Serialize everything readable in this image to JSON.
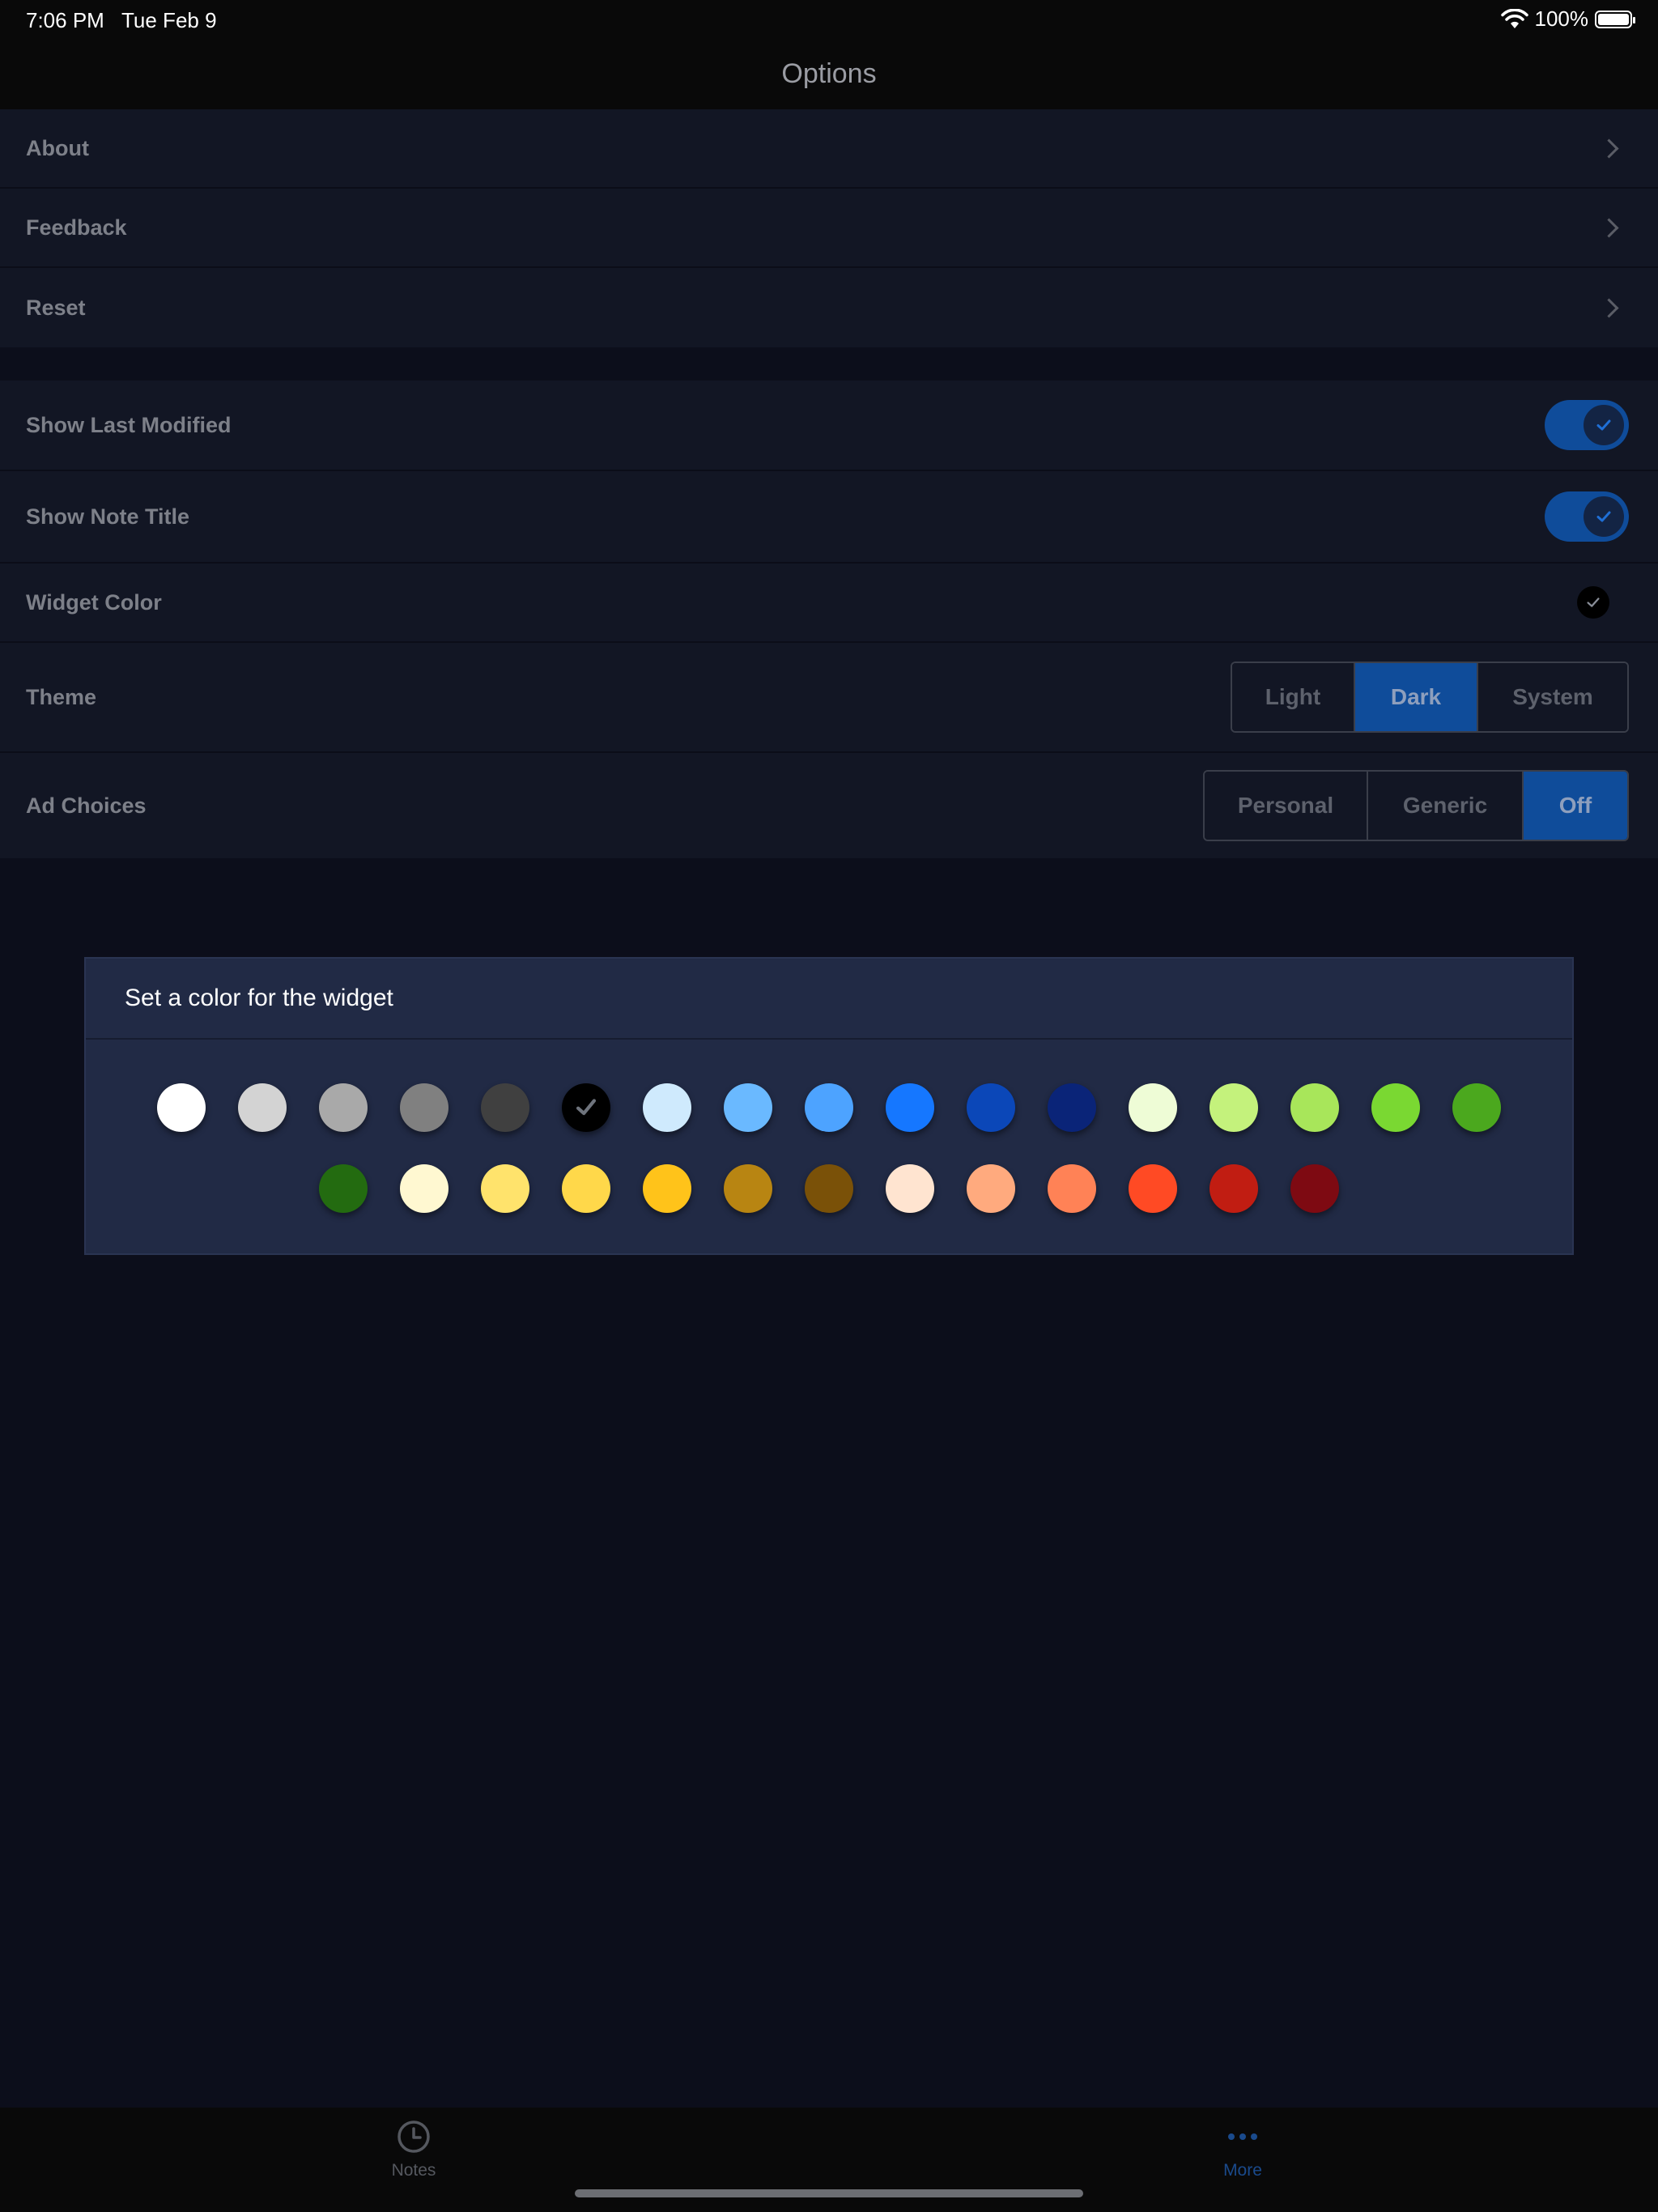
{
  "status_bar": {
    "time": "7:06 PM",
    "date": "Tue Feb 9",
    "battery": "100%"
  },
  "nav": {
    "title": "Options"
  },
  "menu_group": {
    "items": [
      {
        "label": "About"
      },
      {
        "label": "Feedback"
      },
      {
        "label": "Reset"
      }
    ]
  },
  "settings": {
    "show_last_modified": {
      "label": "Show Last Modified",
      "on": true
    },
    "show_note_title": {
      "label": "Show Note Title",
      "on": true
    },
    "widget_color": {
      "label": "Widget Color",
      "value": "#000000"
    },
    "theme": {
      "label": "Theme",
      "options": [
        "Light",
        "Dark",
        "System"
      ],
      "selected": "Dark"
    },
    "ad_choices": {
      "label": "Ad Choices",
      "options": [
        "Personal",
        "Generic",
        "Off"
      ],
      "selected": "Off"
    }
  },
  "dialog": {
    "title": "Set a color for the widget",
    "selected_color": "#000000",
    "colors_row1": [
      "#ffffff",
      "#d3d3d3",
      "#a9a9a9",
      "#808080",
      "#404040",
      "#000000",
      "#cfeafd",
      "#6ab9ff",
      "#4da3ff",
      "#1577ff",
      "#0b47b8",
      "#0a2478",
      "#eefcd6",
      "#c4f27c",
      "#a8e65a",
      "#7ad832",
      "#4ba81e"
    ],
    "colors_row2": [
      "#236b10",
      "#fff8d1",
      "#ffe36c",
      "#ffd84a",
      "#ffc31a",
      "#b88512",
      "#7a5108",
      "#ffe4d0",
      "#ffaa7e",
      "#ff8256",
      "#ff4a24",
      "#c11d12",
      "#7e0a12"
    ]
  },
  "tab_bar": {
    "tabs": [
      {
        "label": "Notes",
        "icon": "clock-icon",
        "active": false
      },
      {
        "label": "More",
        "icon": "ellipsis-icon",
        "active": true
      }
    ]
  },
  "colors": {
    "accent": "#0f4c9a",
    "background": "#0c0e1b",
    "panel": "#121624",
    "dialog": "#212a45"
  }
}
